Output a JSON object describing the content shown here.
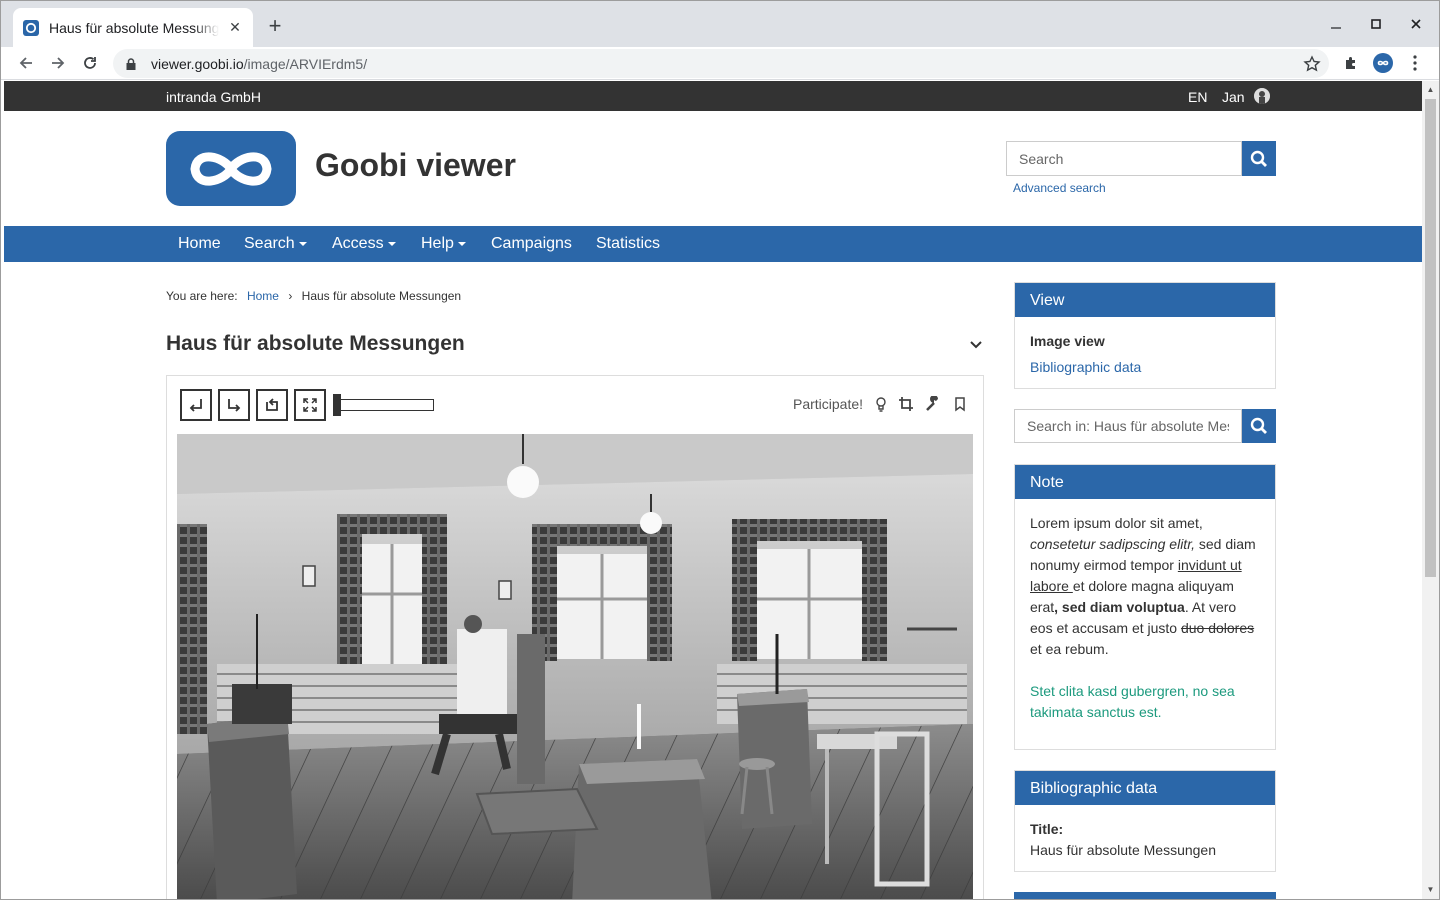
{
  "browser": {
    "tab_title": "Haus für absolute Messungen",
    "url_domain": "viewer.goobi.io",
    "url_path": "/image/ARVIErdm5/"
  },
  "topbar": {
    "company": "intranda GmbH",
    "language": "EN",
    "user": "Jan"
  },
  "header": {
    "site_title": "Goobi viewer",
    "search_placeholder": "Search",
    "advanced_search": "Advanced search"
  },
  "nav": {
    "items": [
      "Home",
      "Search",
      "Access",
      "Help",
      "Campaigns",
      "Statistics"
    ]
  },
  "breadcrumb": {
    "prefix": "You are here:",
    "home": "Home",
    "separator": "›",
    "current": "Haus für absolute Messungen"
  },
  "page": {
    "title": "Haus für absolute Messungen"
  },
  "viewer": {
    "participate": "Participate!",
    "zoom_level": 0
  },
  "sidebar": {
    "view": {
      "heading": "View",
      "active": "Image view",
      "link": "Bibliographic data"
    },
    "search_placeholder": "Search in: Haus für absolute Messungen",
    "note": {
      "heading": "Note",
      "p1_a": "Lorem ipsum dolor sit amet,",
      "p1_b": "consetetur sadipscing elitr,",
      "p1_c": " sed diam nonumy eirmod tempor ",
      "p1_d": "invidunt ut labore ",
      "p1_e": "et dolore magna aliquyam erat",
      "p1_f": ", sed diam voluptua",
      "p1_g": ". At vero eos et accusam et justo ",
      "p1_h": "duo dolores",
      "p1_i": " et ea rebum.",
      "p2": "Stet clita kasd gubergren, no sea takimata sanctus est."
    },
    "biblio": {
      "heading": "Bibliographic data",
      "label": "Title:",
      "value": "Haus für absolute Messungen"
    }
  },
  "colors": {
    "brand": "#2b67a9",
    "topbar": "#333333",
    "note_green": "#1c9a7e"
  }
}
